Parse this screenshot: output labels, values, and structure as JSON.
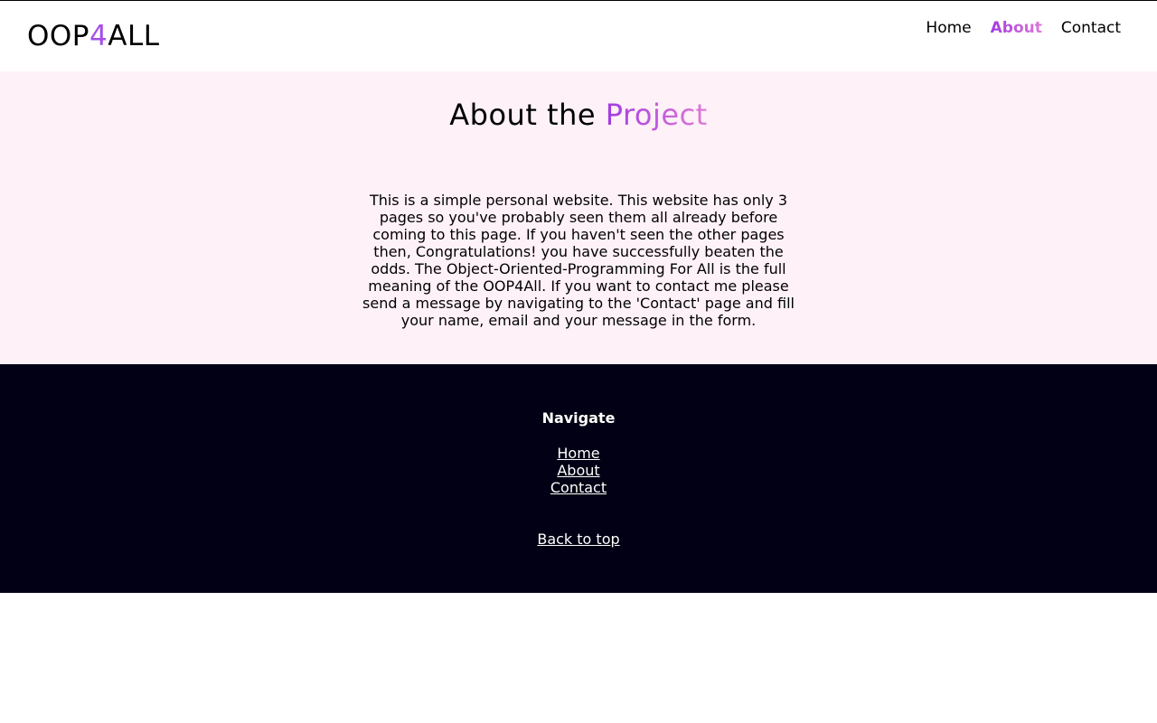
{
  "brand": {
    "part1": "OOP",
    "accent": "4",
    "part2": "ALL"
  },
  "nav": {
    "items": [
      {
        "label": "Home",
        "active": false
      },
      {
        "label": "About",
        "active": true
      },
      {
        "label": "Contact",
        "active": false
      }
    ]
  },
  "hero": {
    "title_prefix": "About the ",
    "title_highlight": "Project",
    "body": "This is a simple personal website. This website has only 3 pages so you've probably seen them all already before coming to this page. If you haven't seen the other pages then, Congratulations! you have successfully beaten the odds. The Object-Oriented-Programming For All is the full meaning of the OOP4All. If you want to contact me please send a message by navigating to the 'Contact' page and fill your name, email and your message in the form."
  },
  "footer": {
    "heading": "Navigate",
    "links": [
      "Home",
      "About",
      "Contact"
    ],
    "back_to_top": "Back to top"
  },
  "colors": {
    "accent": "#a64ee8",
    "gradient_start": "#a23be0",
    "gradient_end": "#e07ad8",
    "hero_bg": "#fff1f8",
    "footer_bg": "#010014"
  }
}
